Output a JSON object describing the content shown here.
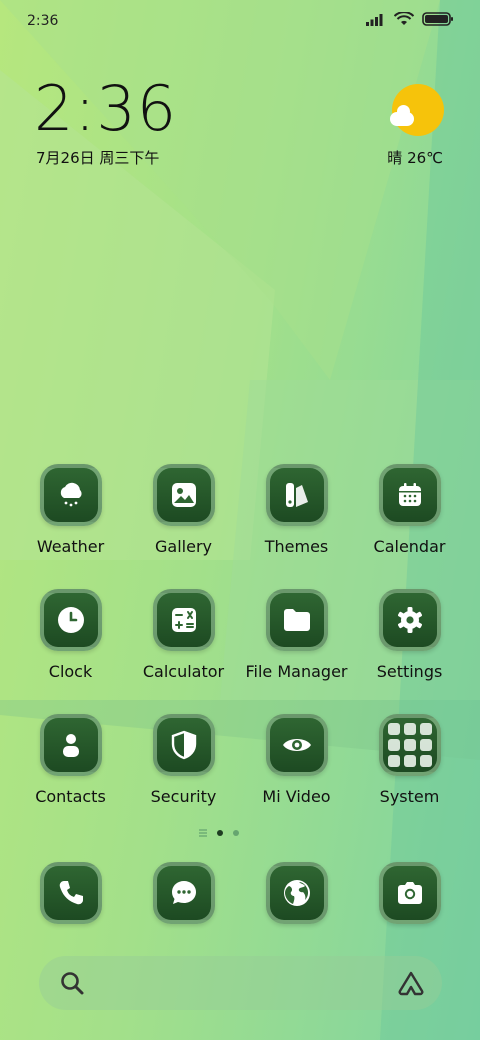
{
  "status_bar": {
    "time": "2:36",
    "icons": [
      "signal-icon",
      "wifi-icon",
      "battery-icon"
    ]
  },
  "clock_widget": {
    "time": "2:36",
    "date": "7月26日 周三下午"
  },
  "weather_widget": {
    "condition_temp": "晴 26℃",
    "icon": "sun-cloud-icon"
  },
  "apps": [
    {
      "label": "Weather",
      "icon": "weather-icon"
    },
    {
      "label": "Gallery",
      "icon": "gallery-icon"
    },
    {
      "label": "Themes",
      "icon": "themes-icon"
    },
    {
      "label": "Calendar",
      "icon": "calendar-icon"
    },
    {
      "label": "Clock",
      "icon": "clock-icon"
    },
    {
      "label": "Calculator",
      "icon": "calculator-icon"
    },
    {
      "label": "File Manager",
      "icon": "folder-icon"
    },
    {
      "label": "Settings",
      "icon": "gear-icon"
    },
    {
      "label": "Contacts",
      "icon": "contacts-icon"
    },
    {
      "label": "Security",
      "icon": "shield-icon"
    },
    {
      "label": "Mi Video",
      "icon": "eye-icon"
    },
    {
      "label": "System",
      "icon": "folder-grid-icon"
    }
  ],
  "dock": [
    {
      "icon": "phone-icon"
    },
    {
      "icon": "messages-icon"
    },
    {
      "icon": "browser-icon"
    },
    {
      "icon": "camera-icon"
    }
  ],
  "page_indicator": {
    "pages": 2,
    "current": 1
  },
  "search_bar": {
    "left_icon": "search-icon",
    "right_icon": "assistant-icon"
  },
  "colors": {
    "tile": "#2f6632",
    "wall_left": "#b6e77e",
    "wall_right": "#7fd3a1",
    "sun": "#f6c30b"
  }
}
